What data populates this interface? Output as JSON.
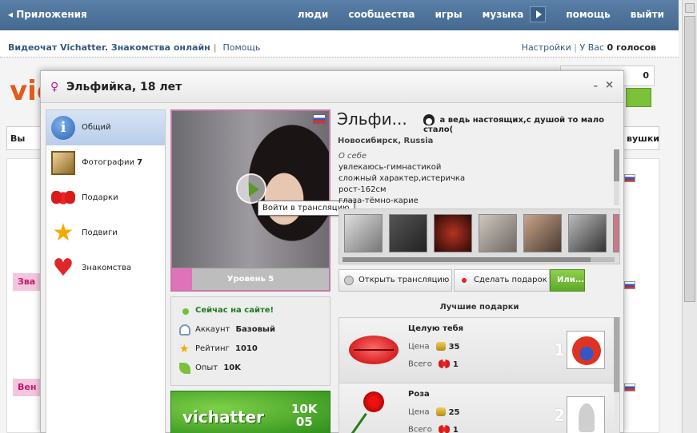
{
  "topnav": {
    "back_label": "Приложения",
    "items": [
      "люди",
      "сообщества",
      "игры",
      "музыка",
      "помощь",
      "выйти"
    ]
  },
  "pagehead": {
    "title": "Видеочат Vichatter. Знакомства онлайн",
    "help": "Помощь",
    "settings": "Настройки",
    "votes_prefix": "У Вас",
    "votes_value": "0 голосов"
  },
  "bg": {
    "logo": "vic",
    "coins": "0",
    "btn_left": "Вы",
    "btn_right": "вушки",
    "pink_labels": [
      "Зва",
      "Вен"
    ]
  },
  "modal": {
    "gender_symbol": "♀",
    "title": "Эльфийка, 18 лет",
    "minimize": "–",
    "close": "×"
  },
  "leftnav": {
    "items": [
      {
        "label": "Общий",
        "icon": "info-icon",
        "count": ""
      },
      {
        "label": "Фотографии",
        "icon": "photos-icon",
        "count": "7"
      },
      {
        "label": "Подарки",
        "icon": "gift-icon",
        "count": ""
      },
      {
        "label": "Подвиги",
        "icon": "star-icon",
        "count": ""
      },
      {
        "label": "Знакомства",
        "icon": "heart-icon",
        "count": ""
      }
    ]
  },
  "photo": {
    "level_label": "Уровень 5",
    "level_progress_pct": 13,
    "tooltip": "Войти в трансляцию"
  },
  "stats": {
    "online": "Сейчас на сайте!",
    "account_label": "Аккаунт",
    "account_value": "Базовый",
    "rating_label": "Рейтинг",
    "rating_value": "1010",
    "exp_label": "Опыт",
    "exp_value": "10K"
  },
  "banner": {
    "logo": "vichatter",
    "line1": "10K",
    "line2": "05"
  },
  "profile": {
    "name": "Эльфи...",
    "status": "а ведь настоящих,с душой то мало стало(",
    "city": "Новосибирск, Russia",
    "about_title": "О себе",
    "about_lines": [
      "увлекаюсь-гимнастикой",
      "сложный характер,истеричка",
      "рост-162см",
      "глаза-тёмно-карие"
    ]
  },
  "actions": {
    "broadcast": "Открыть трансляцию",
    "gift": "Сделать подарок",
    "more": "Или..."
  },
  "gifts": {
    "title": "Лучшие подарки",
    "price_label": "Цена",
    "total_label": "Всего",
    "items": [
      {
        "name": "Целую тебя",
        "price": "35",
        "total": "1",
        "rank": "1"
      },
      {
        "name": "Роза",
        "price": "25",
        "total": "1",
        "rank": "2"
      }
    ]
  },
  "colors": {
    "accent": "#45698f",
    "pink": "#c0188c",
    "green": "#6cc23a"
  }
}
